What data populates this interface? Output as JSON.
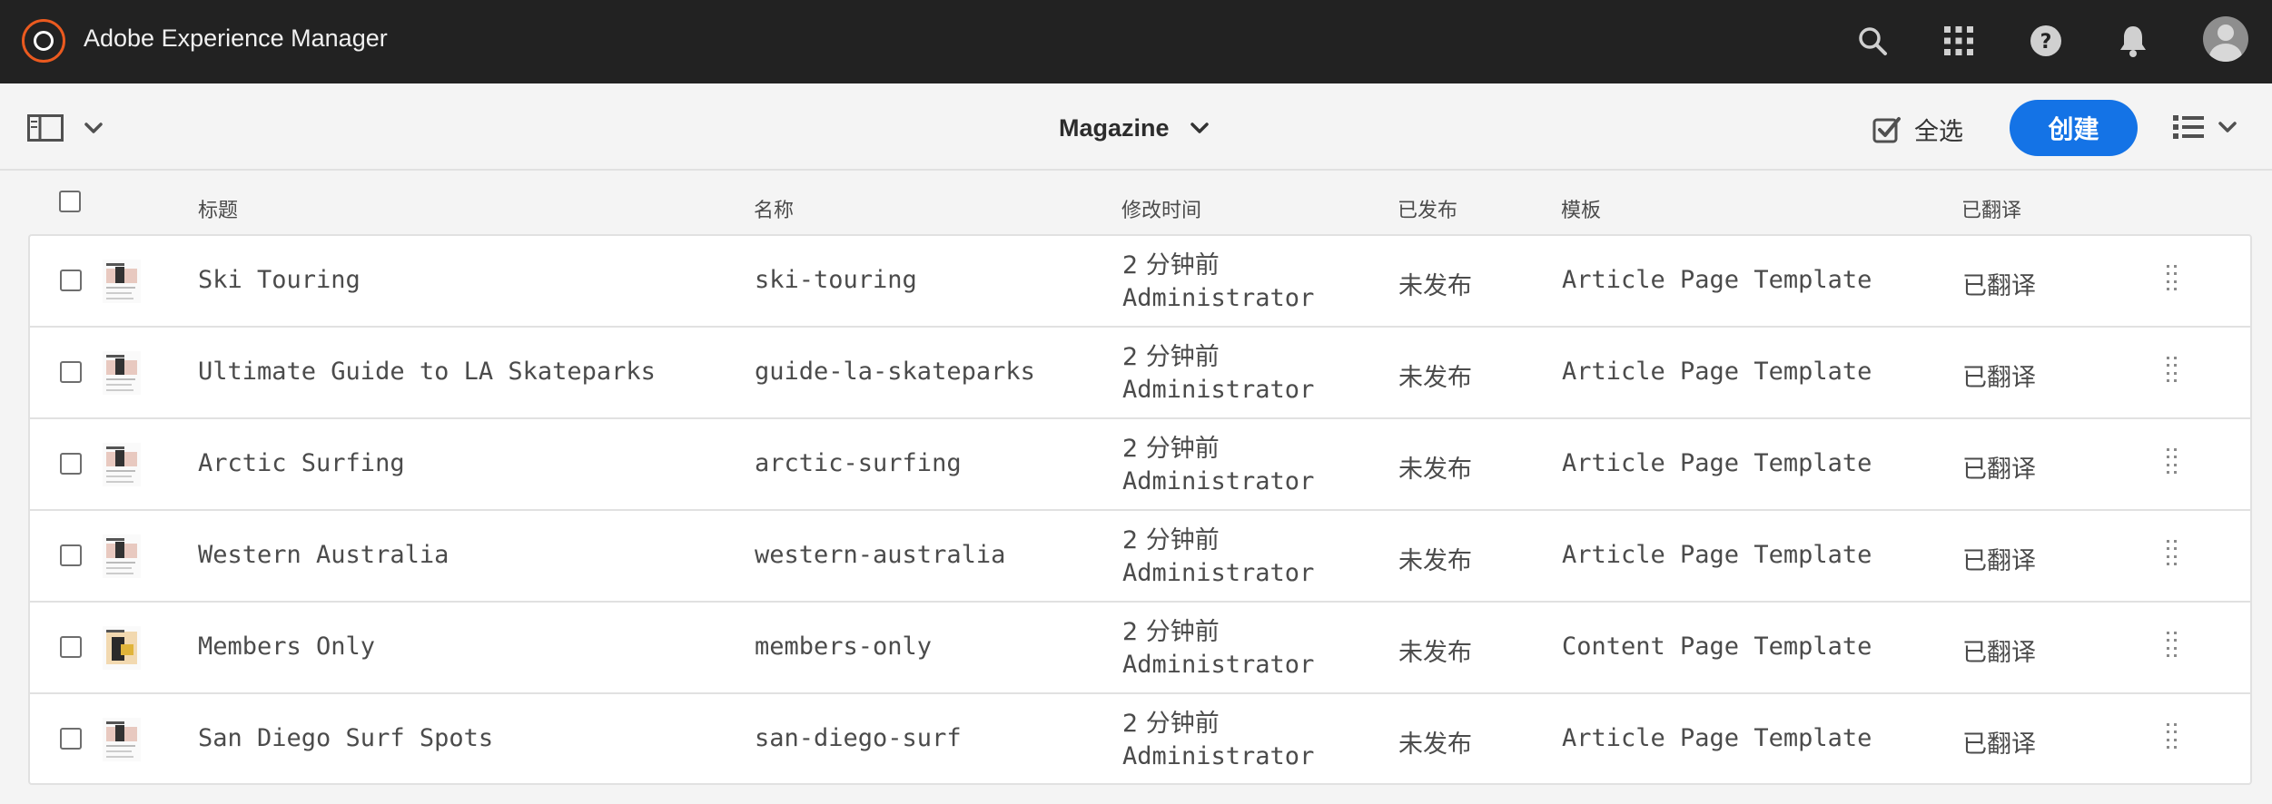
{
  "shell": {
    "app_title": "Adobe Experience Manager",
    "icons": [
      "adobe-experience-manager-logo",
      "search-icon",
      "apps-grid-icon",
      "help-icon",
      "notifications-bell-icon",
      "user-avatar"
    ]
  },
  "actionbar": {
    "title": "Magazine",
    "select_all_label": "全选",
    "create_label": "创建",
    "accent_color": "#1473e6"
  },
  "table": {
    "columns": [
      "标题",
      "名称",
      "修改时间",
      "已发布",
      "模板",
      "已翻译"
    ],
    "rows": [
      {
        "title": "Ski Touring",
        "name": "ski-touring",
        "modified_time": "2 分钟前",
        "modified_by": "Administrator",
        "published": "未发布",
        "template": "Article Page Template",
        "translated": "已翻译"
      },
      {
        "title": "Ultimate Guide to LA Skateparks",
        "name": "guide-la-skateparks",
        "modified_time": "2 分钟前",
        "modified_by": "Administrator",
        "published": "未发布",
        "template": "Article Page Template",
        "translated": "已翻译"
      },
      {
        "title": "Arctic Surfing",
        "name": "arctic-surfing",
        "modified_time": "2 分钟前",
        "modified_by": "Administrator",
        "published": "未发布",
        "template": "Article Page Template",
        "translated": "已翻译"
      },
      {
        "title": "Western Australia",
        "name": "western-australia",
        "modified_time": "2 分钟前",
        "modified_by": "Administrator",
        "published": "未发布",
        "template": "Article Page Template",
        "translated": "已翻译"
      },
      {
        "title": "Members Only",
        "name": "members-only",
        "modified_time": "2 分钟前",
        "modified_by": "Administrator",
        "published": "未发布",
        "template": "Content Page Template",
        "translated": "已翻译"
      },
      {
        "title": "San Diego Surf Spots",
        "name": "san-diego-surf",
        "modified_time": "2 分钟前",
        "modified_by": "Administrator",
        "published": "未发布",
        "template": "Article Page Template",
        "translated": "已翻译"
      }
    ]
  }
}
